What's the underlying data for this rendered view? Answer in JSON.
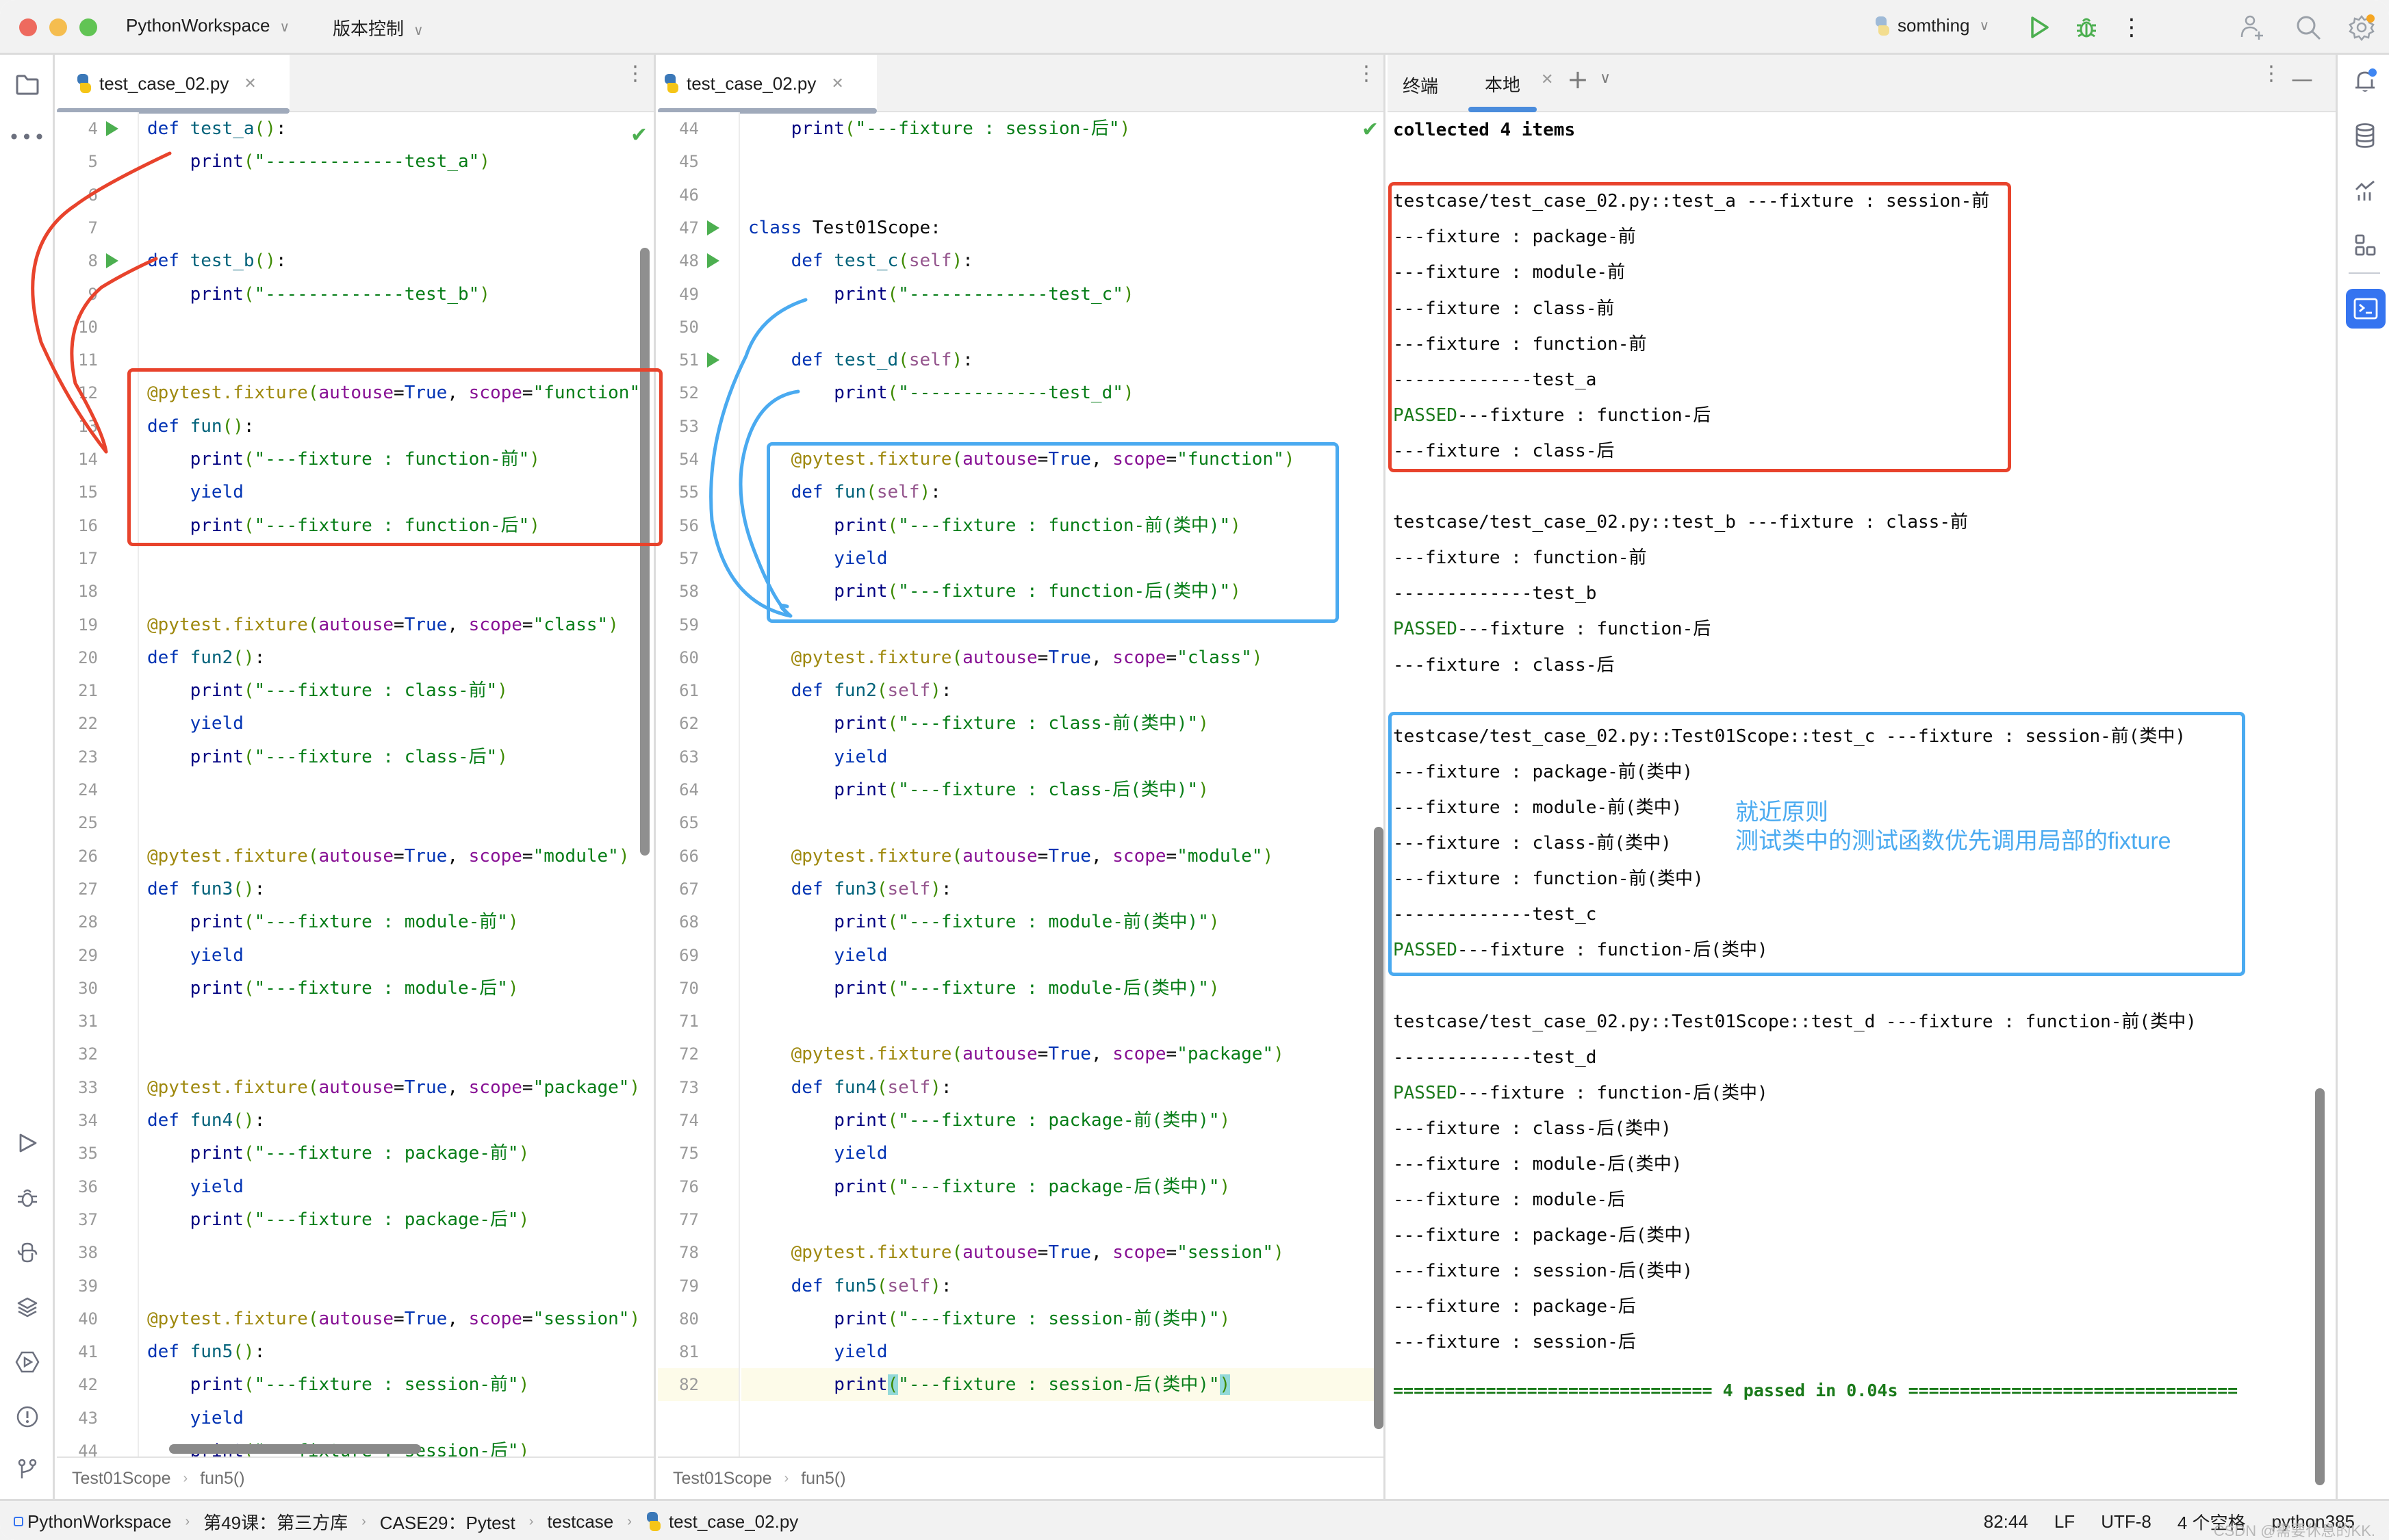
{
  "titlebar": {
    "project": "PythonWorkspace",
    "vcs": "版本控制",
    "run_config": "somthing"
  },
  "left_editor": {
    "tab_label": "test_case_02.py",
    "breadcrumb": [
      "Test01Scope",
      "fun5()"
    ],
    "lines": [
      {
        "n": "4",
        "run": true,
        "html": "<span class=\"kw\">def</span> <span class=\"fn\">test_a</span><span class=\"par\">()</span>:"
      },
      {
        "n": "5",
        "html": "    <span class=\"pr\">print</span><span class=\"par\">(</span><span class=\"st\">\"-------------test_a\"</span><span class=\"par\">)</span>"
      },
      {
        "n": "6",
        "html": ""
      },
      {
        "n": "7",
        "html": ""
      },
      {
        "n": "8",
        "run": true,
        "html": "<span class=\"kw\">def</span> <span class=\"fn\">test_b</span><span class=\"par\">()</span>:"
      },
      {
        "n": "9",
        "html": "    <span class=\"pr\">print</span><span class=\"par\">(</span><span class=\"st\">\"-------------test_b\"</span><span class=\"par\">)</span>"
      },
      {
        "n": "10",
        "html": ""
      },
      {
        "n": "11",
        "html": ""
      },
      {
        "n": "12",
        "html": "<span class=\"dec\">@pytest.fixture</span><span class=\"par\">(</span><span class=\"prm\">autouse</span>=<span class=\"kw\">True</span>, <span class=\"prm\">scope</span>=<span class=\"st\">\"function\"</span><span class=\"par\">)</span>"
      },
      {
        "n": "13",
        "html": "<span class=\"kw\">def</span> <span class=\"fn\">fun</span><span class=\"par\">()</span>:"
      },
      {
        "n": "14",
        "html": "    <span class=\"pr\">print</span><span class=\"par\">(</span><span class=\"st\">\"---fixture : function-前\"</span><span class=\"par\">)</span>"
      },
      {
        "n": "15",
        "html": "    <span class=\"kw\">yield</span>"
      },
      {
        "n": "16",
        "html": "    <span class=\"pr\">print</span><span class=\"par\">(</span><span class=\"st\">\"---fixture : function-后\"</span><span class=\"par\">)</span>"
      },
      {
        "n": "17",
        "html": ""
      },
      {
        "n": "18",
        "html": ""
      },
      {
        "n": "19",
        "html": "<span class=\"dec\">@pytest.fixture</span><span class=\"par\">(</span><span class=\"prm\">autouse</span>=<span class=\"kw\">True</span>, <span class=\"prm\">scope</span>=<span class=\"st\">\"class\"</span><span class=\"par\">)</span>"
      },
      {
        "n": "20",
        "html": "<span class=\"kw\">def</span> <span class=\"fn\">fun2</span><span class=\"par\">()</span>:"
      },
      {
        "n": "21",
        "html": "    <span class=\"pr\">print</span><span class=\"par\">(</span><span class=\"st\">\"---fixture : class-前\"</span><span class=\"par\">)</span>"
      },
      {
        "n": "22",
        "html": "    <span class=\"kw\">yield</span>"
      },
      {
        "n": "23",
        "html": "    <span class=\"pr\">print</span><span class=\"par\">(</span><span class=\"st\">\"---fixture : class-后\"</span><span class=\"par\">)</span>"
      },
      {
        "n": "24",
        "html": ""
      },
      {
        "n": "25",
        "html": ""
      },
      {
        "n": "26",
        "html": "<span class=\"dec\">@pytest.fixture</span><span class=\"par\">(</span><span class=\"prm\">autouse</span>=<span class=\"kw\">True</span>, <span class=\"prm\">scope</span>=<span class=\"st\">\"module\"</span><span class=\"par\">)</span>"
      },
      {
        "n": "27",
        "html": "<span class=\"kw\">def</span> <span class=\"fn\">fun3</span><span class=\"par\">()</span>:"
      },
      {
        "n": "28",
        "html": "    <span class=\"pr\">print</span><span class=\"par\">(</span><span class=\"st\">\"---fixture : module-前\"</span><span class=\"par\">)</span>"
      },
      {
        "n": "29",
        "html": "    <span class=\"kw\">yield</span>"
      },
      {
        "n": "30",
        "html": "    <span class=\"pr\">print</span><span class=\"par\">(</span><span class=\"st\">\"---fixture : module-后\"</span><span class=\"par\">)</span>"
      },
      {
        "n": "31",
        "html": ""
      },
      {
        "n": "32",
        "html": ""
      },
      {
        "n": "33",
        "html": "<span class=\"dec\">@pytest.fixture</span><span class=\"par\">(</span><span class=\"prm\">autouse</span>=<span class=\"kw\">True</span>, <span class=\"prm\">scope</span>=<span class=\"st\">\"package\"</span><span class=\"par\">)</span>"
      },
      {
        "n": "34",
        "html": "<span class=\"kw\">def</span> <span class=\"fn\">fun4</span><span class=\"par\">()</span>:"
      },
      {
        "n": "35",
        "html": "    <span class=\"pr\">print</span><span class=\"par\">(</span><span class=\"st\">\"---fixture : package-前\"</span><span class=\"par\">)</span>"
      },
      {
        "n": "36",
        "html": "    <span class=\"kw\">yield</span>"
      },
      {
        "n": "37",
        "html": "    <span class=\"pr\">print</span><span class=\"par\">(</span><span class=\"st\">\"---fixture : package-后\"</span><span class=\"par\">)</span>"
      },
      {
        "n": "38",
        "html": ""
      },
      {
        "n": "39",
        "html": ""
      },
      {
        "n": "40",
        "html": "<span class=\"dec\">@pytest.fixture</span><span class=\"par\">(</span><span class=\"prm\">autouse</span>=<span class=\"kw\">True</span>, <span class=\"prm\">scope</span>=<span class=\"st\">\"session\"</span><span class=\"par\">)</span>"
      },
      {
        "n": "41",
        "html": "<span class=\"kw\">def</span> <span class=\"fn\">fun5</span><span class=\"par\">()</span>:"
      },
      {
        "n": "42",
        "html": "    <span class=\"pr\">print</span><span class=\"par\">(</span><span class=\"st\">\"---fixture : session-前\"</span><span class=\"par\">)</span>"
      },
      {
        "n": "43",
        "html": "    <span class=\"kw\">yield</span>"
      },
      {
        "n": "44",
        "html": "    <span class=\"pr\">print</span><span class=\"par\">(</span><span class=\"st\">\"---fixture : session-后\"</span><span class=\"par\">)</span>"
      }
    ]
  },
  "right_editor": {
    "tab_label": "test_case_02.py",
    "breadcrumb": [
      "Test01Scope",
      "fun5()"
    ],
    "lines": [
      {
        "n": "44",
        "html": "    <span class=\"pr\">print</span><span class=\"par\">(</span><span class=\"st\">\"---fixture : session-后\"</span><span class=\"par\">)</span>"
      },
      {
        "n": "45",
        "html": ""
      },
      {
        "n": "46",
        "html": ""
      },
      {
        "n": "47",
        "run": true,
        "html": "<span class=\"kw\">class</span> Test01Scope:"
      },
      {
        "n": "48",
        "run": true,
        "html": "    <span class=\"kw\">def</span> <span class=\"fn\">test_c</span><span class=\"par\">(</span><span class=\"slf\">self</span><span class=\"par\">)</span>:"
      },
      {
        "n": "49",
        "html": "        <span class=\"pr\">print</span><span class=\"par\">(</span><span class=\"st\">\"-------------test_c\"</span><span class=\"par\">)</span>"
      },
      {
        "n": "50",
        "html": ""
      },
      {
        "n": "51",
        "run": true,
        "html": "    <span class=\"kw\">def</span> <span class=\"fn\">test_d</span><span class=\"par\">(</span><span class=\"slf\">self</span><span class=\"par\">)</span>:"
      },
      {
        "n": "52",
        "html": "        <span class=\"pr\">print</span><span class=\"par\">(</span><span class=\"st\">\"-------------test_d\"</span><span class=\"par\">)</span>"
      },
      {
        "n": "53",
        "html": ""
      },
      {
        "n": "54",
        "html": "    <span class=\"dec\">@pytest.fixture</span><span class=\"par\">(</span><span class=\"prm\">autouse</span>=<span class=\"kw\">True</span>, <span class=\"prm\">scope</span>=<span class=\"st\">\"function\"</span><span class=\"par\">)</span>"
      },
      {
        "n": "55",
        "html": "    <span class=\"kw\">def</span> <span class=\"fn\">fun</span><span class=\"par\">(</span><span class=\"slf\">self</span><span class=\"par\">)</span>:"
      },
      {
        "n": "56",
        "html": "        <span class=\"pr\">print</span><span class=\"par\">(</span><span class=\"st\">\"---fixture : function-前(类中)\"</span><span class=\"par\">)</span>"
      },
      {
        "n": "57",
        "html": "        <span class=\"kw\">yield</span>"
      },
      {
        "n": "58",
        "html": "        <span class=\"pr\">print</span><span class=\"par\">(</span><span class=\"st\">\"---fixture : function-后(类中)\"</span><span class=\"par\">)</span>"
      },
      {
        "n": "59",
        "html": ""
      },
      {
        "n": "60",
        "html": "    <span class=\"dec\">@pytest.fixture</span><span class=\"par\">(</span><span class=\"prm\">autouse</span>=<span class=\"kw\">True</span>, <span class=\"prm\">scope</span>=<span class=\"st\">\"class\"</span><span class=\"par\">)</span>"
      },
      {
        "n": "61",
        "html": "    <span class=\"kw\">def</span> <span class=\"fn\">fun2</span><span class=\"par\">(</span><span class=\"slf\">self</span><span class=\"par\">)</span>:"
      },
      {
        "n": "62",
        "html": "        <span class=\"pr\">print</span><span class=\"par\">(</span><span class=\"st\">\"---fixture : class-前(类中)\"</span><span class=\"par\">)</span>"
      },
      {
        "n": "63",
        "html": "        <span class=\"kw\">yield</span>"
      },
      {
        "n": "64",
        "html": "        <span class=\"pr\">print</span><span class=\"par\">(</span><span class=\"st\">\"---fixture : class-后(类中)\"</span><span class=\"par\">)</span>"
      },
      {
        "n": "65",
        "html": ""
      },
      {
        "n": "66",
        "html": "    <span class=\"dec\">@pytest.fixture</span><span class=\"par\">(</span><span class=\"prm\">autouse</span>=<span class=\"kw\">True</span>, <span class=\"prm\">scope</span>=<span class=\"st\">\"module\"</span><span class=\"par\">)</span>"
      },
      {
        "n": "67",
        "html": "    <span class=\"kw\">def</span> <span class=\"fn\">fun3</span><span class=\"par\">(</span><span class=\"slf\">self</span><span class=\"par\">)</span>:"
      },
      {
        "n": "68",
        "html": "        <span class=\"pr\">print</span><span class=\"par\">(</span><span class=\"st\">\"---fixture : module-前(类中)\"</span><span class=\"par\">)</span>"
      },
      {
        "n": "69",
        "html": "        <span class=\"kw\">yield</span>"
      },
      {
        "n": "70",
        "html": "        <span class=\"pr\">print</span><span class=\"par\">(</span><span class=\"st\">\"---fixture : module-后(类中)\"</span><span class=\"par\">)</span>"
      },
      {
        "n": "71",
        "html": ""
      },
      {
        "n": "72",
        "html": "    <span class=\"dec\">@pytest.fixture</span><span class=\"par\">(</span><span class=\"prm\">autouse</span>=<span class=\"kw\">True</span>, <span class=\"prm\">scope</span>=<span class=\"st\">\"package\"</span><span class=\"par\">)</span>"
      },
      {
        "n": "73",
        "html": "    <span class=\"kw\">def</span> <span class=\"fn\">fun4</span><span class=\"par\">(</span><span class=\"slf\">self</span><span class=\"par\">)</span>:"
      },
      {
        "n": "74",
        "html": "        <span class=\"pr\">print</span><span class=\"par\">(</span><span class=\"st\">\"---fixture : package-前(类中)\"</span><span class=\"par\">)</span>"
      },
      {
        "n": "75",
        "html": "        <span class=\"kw\">yield</span>"
      },
      {
        "n": "76",
        "html": "        <span class=\"pr\">print</span><span class=\"par\">(</span><span class=\"st\">\"---fixture : package-后(类中)\"</span><span class=\"par\">)</span>"
      },
      {
        "n": "77",
        "html": ""
      },
      {
        "n": "78",
        "html": "    <span class=\"dec\">@pytest.fixture</span><span class=\"par\">(</span><span class=\"prm\">autouse</span>=<span class=\"kw\">True</span>, <span class=\"prm\">scope</span>=<span class=\"st\">\"session\"</span><span class=\"par\">)</span>"
      },
      {
        "n": "79",
        "html": "    <span class=\"kw\">def</span> <span class=\"fn\">fun5</span><span class=\"par\">(</span><span class=\"slf\">self</span><span class=\"par\">)</span>:"
      },
      {
        "n": "80",
        "html": "        <span class=\"pr\">print</span><span class=\"par\">(</span><span class=\"st\">\"---fixture : session-前(类中)\"</span><span class=\"par\">)</span>"
      },
      {
        "n": "81",
        "html": "        <span class=\"kw\">yield</span>"
      },
      {
        "n": "82",
        "current": true,
        "html": "        <span class=\"pr\">print</span><span class=\"par\" style=\"background:#93d9d9\">(</span><span class=\"st\">\"---fixture : session-后(类中)\"</span><span class=\"par\" style=\"background:#93d9d9\">)</span>"
      }
    ]
  },
  "terminal": {
    "tabs": [
      "终端",
      "本地"
    ],
    "active_tab": "本地",
    "lines": [
      {
        "t": "collected 4 items",
        "bold": true
      },
      {
        "t": ""
      },
      {
        "t": "testcase/test_case_02.py::test_a ---fixture : session-前"
      },
      {
        "t": "---fixture : package-前"
      },
      {
        "t": "---fixture : module-前"
      },
      {
        "t": "---fixture : class-前"
      },
      {
        "t": "---fixture : function-前"
      },
      {
        "t": "-------------test_a"
      },
      {
        "t": "---fixture : function-后",
        "passed": "PASSED"
      },
      {
        "t": "---fixture : class-后"
      },
      {
        "t": ""
      },
      {
        "t": "testcase/test_case_02.py::test_b ---fixture : class-前"
      },
      {
        "t": "---fixture : function-前"
      },
      {
        "t": "-------------test_b"
      },
      {
        "t": "---fixture : function-后",
        "passed": "PASSED"
      },
      {
        "t": "---fixture : class-后"
      },
      {
        "t": ""
      },
      {
        "t": "testcase/test_case_02.py::Test01Scope::test_c ---fixture : session-前(类中)"
      },
      {
        "t": "---fixture : package-前(类中)"
      },
      {
        "t": "---fixture : module-前(类中)"
      },
      {
        "t": "---fixture : class-前(类中)"
      },
      {
        "t": "---fixture : function-前(类中)"
      },
      {
        "t": "-------------test_c"
      },
      {
        "t": "---fixture : function-后(类中)",
        "passed": "PASSED"
      },
      {
        "t": ""
      },
      {
        "t": "testcase/test_case_02.py::Test01Scope::test_d ---fixture : function-前(类中)"
      },
      {
        "t": "-------------test_d"
      },
      {
        "t": "---fixture : function-后(类中)",
        "passed": "PASSED"
      },
      {
        "t": "---fixture : class-后(类中)"
      },
      {
        "t": "---fixture : module-后(类中)"
      },
      {
        "t": "---fixture : module-后"
      },
      {
        "t": "---fixture : package-后(类中)"
      },
      {
        "t": "---fixture : session-后(类中)"
      },
      {
        "t": "---fixture : package-后"
      },
      {
        "t": "---fixture : session-后"
      }
    ],
    "summary": "=============================== 4 passed in 0.04s ================================"
  },
  "annotation": {
    "title": "就近原则",
    "text": "测试类中的测试函数优先调用局部的fixture"
  },
  "statusbar": {
    "crumbs": [
      "PythonWorkspace",
      "第49课：第三方库",
      "CASE29：Pytest",
      "testcase",
      "test_case_02.py"
    ],
    "position": "82:44",
    "line_sep": "LF",
    "encoding": "UTF-8",
    "indent": "4 个空格",
    "interpreter": "python385"
  },
  "watermark": "CSDN @需要休息的KK.",
  "colors": {
    "red_box": "#e8432c",
    "blue_box": "#4aaaf0",
    "passed": "#1a7a1a",
    "accent": "#3574f0"
  }
}
